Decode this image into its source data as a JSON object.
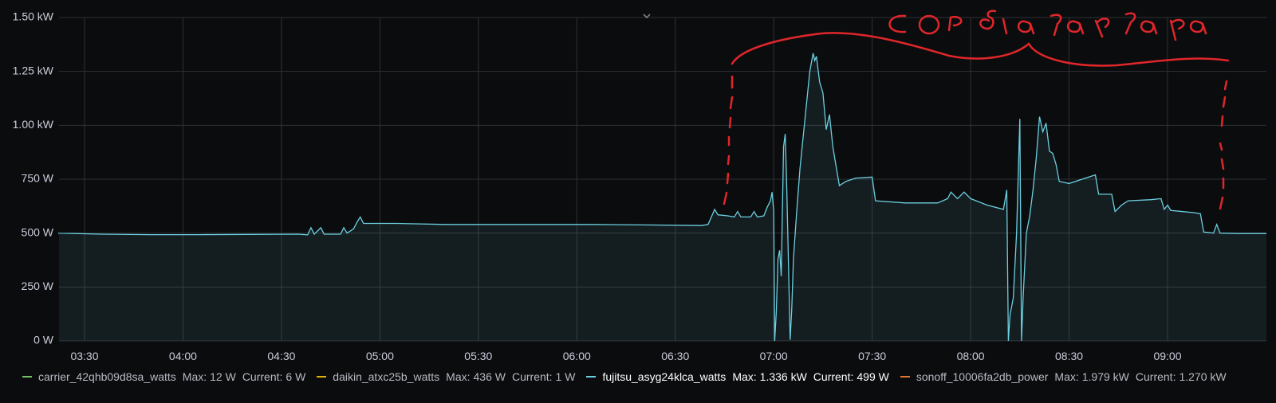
{
  "colors": {
    "background": "#0b0c0e",
    "grid": "#2f3136",
    "fujitsu": "#6ccfe0",
    "annotation": "#e0262a"
  },
  "annotation_text": "COP δεν λειτουργεί",
  "chart_data": {
    "type": "area",
    "y_unit_ticks": [
      "0 W",
      "250 W",
      "500 W",
      "750 W",
      "1.00 kW",
      "1.25 kW",
      "1.50 kW"
    ],
    "ylim": [
      0,
      1500
    ],
    "x_ticks": [
      "03:30",
      "04:00",
      "04:30",
      "05:00",
      "05:30",
      "06:00",
      "06:30",
      "07:00",
      "07:30",
      "08:00",
      "08:30",
      "09:00"
    ],
    "series": [
      {
        "name": "fujitsu_asyg24klca_watts",
        "unit": "W",
        "points": [
          [
            "03:22",
            500
          ],
          [
            "03:35",
            495
          ],
          [
            "03:50",
            493
          ],
          [
            "04:05",
            493
          ],
          [
            "04:20",
            494
          ],
          [
            "04:35",
            495
          ],
          [
            "04:38",
            492
          ],
          [
            "04:39",
            525
          ],
          [
            "04:40",
            495
          ],
          [
            "04:42",
            525
          ],
          [
            "04:43",
            495
          ],
          [
            "04:48",
            495
          ],
          [
            "04:49",
            525
          ],
          [
            "04:50",
            500
          ],
          [
            "04:52",
            520
          ],
          [
            "04:53",
            550
          ],
          [
            "04:54",
            575
          ],
          [
            "04:55",
            545
          ],
          [
            "05:05",
            545
          ],
          [
            "05:20",
            540
          ],
          [
            "05:35",
            540
          ],
          [
            "05:50",
            540
          ],
          [
            "06:05",
            540
          ],
          [
            "06:20",
            538
          ],
          [
            "06:38",
            535
          ],
          [
            "06:40",
            540
          ],
          [
            "06:41",
            575
          ],
          [
            "06:42",
            610
          ],
          [
            "06:43",
            585
          ],
          [
            "06:46",
            580
          ],
          [
            "06:48",
            575
          ],
          [
            "06:49",
            600
          ],
          [
            "06:50",
            575
          ],
          [
            "06:53",
            575
          ],
          [
            "06:54",
            600
          ],
          [
            "06:55",
            575
          ],
          [
            "06:57",
            580
          ],
          [
            "06:58",
            620
          ],
          [
            "06:59",
            650
          ],
          [
            "06:59.5",
            690
          ],
          [
            "07:00",
            600
          ],
          [
            "07:00.3",
            0
          ],
          [
            "07:00.8",
            140
          ],
          [
            "07:01.3",
            380
          ],
          [
            "07:01.8",
            420
          ],
          [
            "07:02.3",
            300
          ],
          [
            "07:03",
            900
          ],
          [
            "07:03.5",
            960
          ],
          [
            "07:04",
            700
          ],
          [
            "07:05",
            5
          ],
          [
            "07:05.5",
            150
          ],
          [
            "07:06",
            380
          ],
          [
            "07:07",
            600
          ],
          [
            "07:08",
            800
          ],
          [
            "07:09",
            950
          ],
          [
            "07:10",
            1100
          ],
          [
            "07:11",
            1250
          ],
          [
            "07:12",
            1335
          ],
          [
            "07:12.5",
            1300
          ],
          [
            "07:13",
            1320
          ],
          [
            "07:14",
            1200
          ],
          [
            "07:15",
            1150
          ],
          [
            "07:16",
            980
          ],
          [
            "07:17",
            1050
          ],
          [
            "07:18",
            900
          ],
          [
            "07:20",
            720
          ],
          [
            "07:22",
            740
          ],
          [
            "07:25",
            755
          ],
          [
            "07:30",
            760
          ],
          [
            "07:31",
            650
          ],
          [
            "07:40",
            640
          ],
          [
            "07:50",
            640
          ],
          [
            "07:53",
            660
          ],
          [
            "07:54",
            690
          ],
          [
            "07:56",
            660
          ],
          [
            "07:58",
            690
          ],
          [
            "08:00",
            660
          ],
          [
            "08:05",
            630
          ],
          [
            "08:10",
            610
          ],
          [
            "08:11",
            700
          ],
          [
            "08:11.5",
            0
          ],
          [
            "08:12",
            120
          ],
          [
            "08:13",
            200
          ],
          [
            "08:14",
            500
          ],
          [
            "08:15",
            1030
          ],
          [
            "08:15.5",
            0
          ],
          [
            "08:16",
            200
          ],
          [
            "08:17",
            500
          ],
          [
            "08:18",
            580
          ],
          [
            "08:19",
            700
          ],
          [
            "08:20",
            850
          ],
          [
            "08:21",
            1040
          ],
          [
            "08:22",
            970
          ],
          [
            "08:23",
            1010
          ],
          [
            "08:24",
            880
          ],
          [
            "08:25",
            870
          ],
          [
            "08:26",
            820
          ],
          [
            "08:27",
            740
          ],
          [
            "08:30",
            730
          ],
          [
            "08:35",
            755
          ],
          [
            "08:38",
            770
          ],
          [
            "08:39",
            680
          ],
          [
            "08:43",
            680
          ],
          [
            "08:44",
            600
          ],
          [
            "08:46",
            630
          ],
          [
            "08:48",
            650
          ],
          [
            "08:55",
            655
          ],
          [
            "08:58",
            660
          ],
          [
            "08:59",
            610
          ],
          [
            "09:00",
            630
          ],
          [
            "09:01",
            605
          ],
          [
            "09:08",
            595
          ],
          [
            "09:10",
            590
          ],
          [
            "09:11",
            505
          ],
          [
            "09:14",
            500
          ],
          [
            "09:15",
            540
          ],
          [
            "09:16",
            500
          ],
          [
            "09:22",
            498
          ]
        ]
      }
    ],
    "legend": [
      {
        "name": "carrier_42qhb09d8sa_watts",
        "max_label": "Max:",
        "max": "12 W",
        "current_label": "Current:",
        "current": "6 W",
        "color": "#73bf69"
      },
      {
        "name": "daikin_atxc25b_watts",
        "max_label": "Max:",
        "max": "436 W",
        "current_label": "Current:",
        "current": "1 W",
        "color": "#e0b400"
      },
      {
        "name": "fujitsu_asyg24klca_watts",
        "max_label": "Max:",
        "max": "1.336 kW",
        "current_label": "Current:",
        "current": "499 W",
        "color": "#6ccfe0"
      },
      {
        "name": "sonoff_10006fa2db_power",
        "max_label": "Max:",
        "max": "1.979 kW",
        "current_label": "Current:",
        "current": "1.270 kW",
        "color": "#e0752d"
      }
    ]
  }
}
